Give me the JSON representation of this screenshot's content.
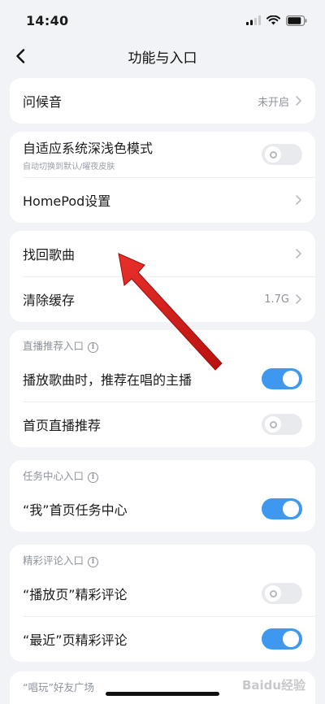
{
  "status_bar": {
    "time": "14:40"
  },
  "nav": {
    "title": "功能与入口"
  },
  "greeting": {
    "label": "问候音",
    "value": "未开启"
  },
  "theme": {
    "adaptive_label": "自适应系统深浅色模式",
    "adaptive_sub": "自动切换到默认/曜夜皮肤",
    "adaptive_on": false,
    "homepod_label": "HomePod设置"
  },
  "storage": {
    "recover_label": "找回歌曲",
    "clear_label": "清除缓存",
    "cache_value": "1.7G"
  },
  "live": {
    "section": "直播推荐入口",
    "rec_on_play_label": "播放歌曲时，推荐在唱的主播",
    "rec_on_play_on": true,
    "home_live_label": "首页直播推荐",
    "home_live_on": false
  },
  "task": {
    "section": "任务中心入口",
    "my_task_label": "“我”首页任务中心",
    "my_task_on": true
  },
  "comments": {
    "section": "精彩评论入口",
    "play_page_label": "“播放页”精彩评论",
    "play_page_on": false,
    "recent_label": "“最近”页精彩评论",
    "recent_on": true
  },
  "friends": {
    "section": "“唱玩”好友广场"
  },
  "watermark": {
    "text": "Baidu经验"
  },
  "colors": {
    "accent": "#3f98f0",
    "annotation_arrow": "#d9211f"
  }
}
